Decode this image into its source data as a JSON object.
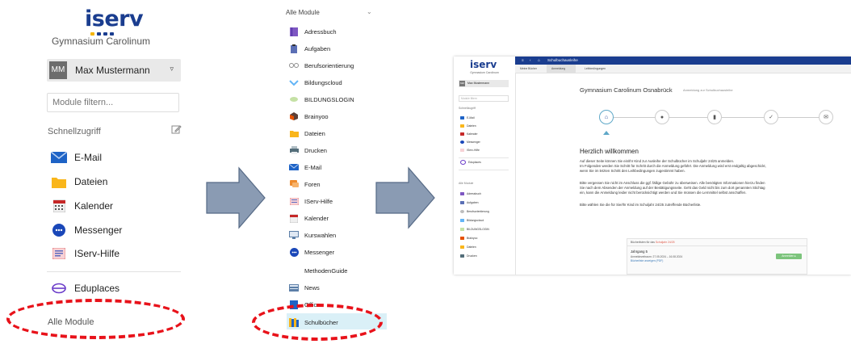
{
  "panel1": {
    "logo": "iserv",
    "school": "Gymnasium Carolinum",
    "user": {
      "initials": "MM",
      "name": "Max Mustermann"
    },
    "filter_placeholder": "Module filtern...",
    "quick_access_label": "Schnellzugriff",
    "items": [
      {
        "label": "E-Mail",
        "icon": "mail-icon"
      },
      {
        "label": "Dateien",
        "icon": "folder-icon"
      },
      {
        "label": "Kalender",
        "icon": "calendar-icon"
      },
      {
        "label": "Messenger",
        "icon": "messenger-icon"
      },
      {
        "label": "IServ-Hilfe",
        "icon": "help-icon"
      }
    ],
    "eduplaces": "Eduplaces",
    "all_modules": "Alle Module",
    "highlight_color": "#e8121a"
  },
  "panel2": {
    "header": "Alle Module",
    "items": [
      "Adressbuch",
      "Aufgaben",
      "Berufsorientierung",
      "Bildungscloud",
      "BILDUNGSLOGIN",
      "Brainyoo",
      "Dateien",
      "Drucken",
      "E-Mail",
      "Foren",
      "IServ-Hilfe",
      "Kalender",
      "Kurswahlen",
      "Messenger",
      "MethodenGuide",
      "News",
      "Office",
      "Schulbücher"
    ],
    "highlight_color": "#e8121a"
  },
  "panel3": {
    "logo": "iserv",
    "school": "Gymnasium Carolinum",
    "user": {
      "initials": "MM",
      "name": "Max Mustermann"
    },
    "filter_placeholder": "Module filtern",
    "quick_access_label": "Schnellzugriff",
    "quick_items": [
      "E-Mail",
      "Dateien",
      "Kalender",
      "Messenger",
      "IServ-Hilfe"
    ],
    "eduplaces": "Eduplaces",
    "all_modules_label": "Alle Module",
    "modules": [
      "Adressbuch",
      "Aufgaben",
      "Berufsorientierung",
      "Bildungscloud",
      "BILDUNGSLOGIN",
      "Brainyoo",
      "Dateien",
      "Drucken"
    ],
    "topbar_title": "Schulbuchausleihe",
    "tabs": [
      "Meine Bücher",
      "Anmeldung",
      "Leihbedingungen"
    ],
    "heading": "Gymnasium Carolinum Osnabrück",
    "heading_sub": "Anmeldung zur Schulbuchausleihe",
    "welcome": "Herzlich willkommen",
    "paragraphs": [
      "Auf dieser Seite können Sie ein/Ihr Kind zur Ausleihe der Schulbücher im Schuljahr 24/25 anmelden.",
      "Im Folgenden werden Sie Schritt für Schritt durch die Anmeldung geführt. Die Anmeldung wird erst endgültig abgeschickt,",
      "wenn Sie im letzten Schritt den Leihbedingungen zugestimmt haben.",
      "Bitte vergessen Sie nicht im Anschluss die ggf. fällige Gebühr zu überweisen. Alle benötigten Informationen hierzu finden",
      "Sie nach dem Absenden der Anmeldung auf der Bestätigungsseite. Geht das Geld nicht bis zum dort genannten Stichtag",
      "ein, kann die Anmeldung leider nicht berücksichtigt werden und Sie müssen die Lernmittel selbst anschaffen.",
      "Bitte wählen Sie die für Sie/Ihr Kind im Schuljahr 24/25 zutreffende Bücherliste."
    ],
    "card": {
      "header": "Bücherlisten für das ",
      "header_red": "Schuljahr 24/25",
      "jahrgang": "Jahrgang 5",
      "zeitraum": "Anmeldezeitraum: 27.05.2024 – 16.08.2024",
      "link": "Bücherliste anzeigen (PDF)",
      "button": "Anmelden ▸"
    },
    "brand_color": "#1a3d8f"
  }
}
